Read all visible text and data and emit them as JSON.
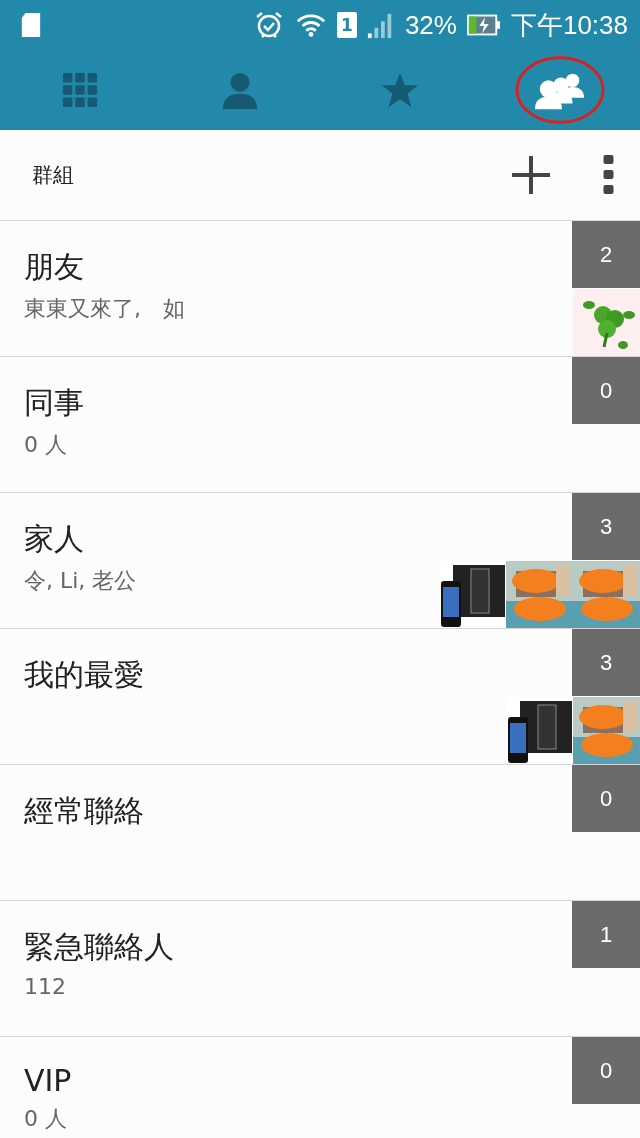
{
  "status_bar": {
    "sim_slot": "1",
    "battery": "32%",
    "time": "下午10:38"
  },
  "tabs": [
    {
      "selected": false,
      "circled": false
    },
    {
      "selected": false,
      "circled": false
    },
    {
      "selected": false,
      "circled": false
    },
    {
      "selected": true,
      "circled": true
    }
  ],
  "header": {
    "title": "群組"
  },
  "groups": [
    {
      "name": "朋友",
      "subtitle": "東東又來了,　如",
      "count": "2"
    },
    {
      "name": "同事",
      "subtitle": "0 人",
      "count": "0"
    },
    {
      "name": "家人",
      "subtitle": "令, Li, 老公",
      "count": "3"
    },
    {
      "name": "我的最愛",
      "count": "3"
    },
    {
      "name": "經常聯絡",
      "count": "0"
    },
    {
      "name": "緊急聯絡人",
      "subtitle": "112",
      "count": "1"
    },
    {
      "name": "VIP",
      "subtitle": "0 人",
      "count": "0"
    }
  ]
}
